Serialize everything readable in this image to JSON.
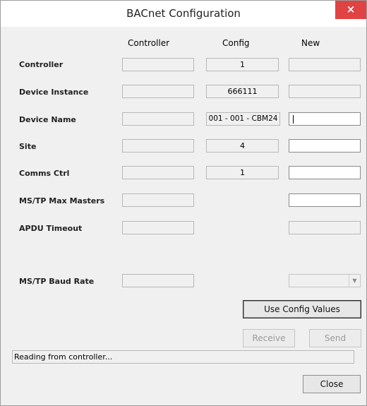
{
  "window": {
    "title": "BACnet Configuration",
    "close_glyph": "×"
  },
  "columns": {
    "controller": "Controller",
    "config": "Config",
    "new": "New"
  },
  "rows": [
    {
      "label": "Controller",
      "controller": "",
      "config": "1",
      "new": ""
    },
    {
      "label": "Device Instance",
      "controller": "",
      "config": "666111",
      "new": ""
    },
    {
      "label": "Device Name",
      "controller": "",
      "config": "001 - 001 - CBM24",
      "new": ""
    },
    {
      "label": "Site",
      "controller": "",
      "config": "4",
      "new": ""
    },
    {
      "label": "Comms Ctrl",
      "controller": "",
      "config": "1",
      "new": ""
    },
    {
      "label": "MS/TP Max Masters",
      "controller": "",
      "new": ""
    },
    {
      "label": "APDU Timeout",
      "controller": "",
      "new": ""
    },
    {
      "label": "MS/TP Baud Rate",
      "controller": "",
      "new": ""
    }
  ],
  "buttons": {
    "use_config": "Use Config Values",
    "receive": "Receive",
    "send": "Send",
    "close": "Close"
  },
  "status": "Reading from controller...",
  "icons": {
    "close": "close-icon",
    "dropdown": "chevron-down-icon"
  }
}
